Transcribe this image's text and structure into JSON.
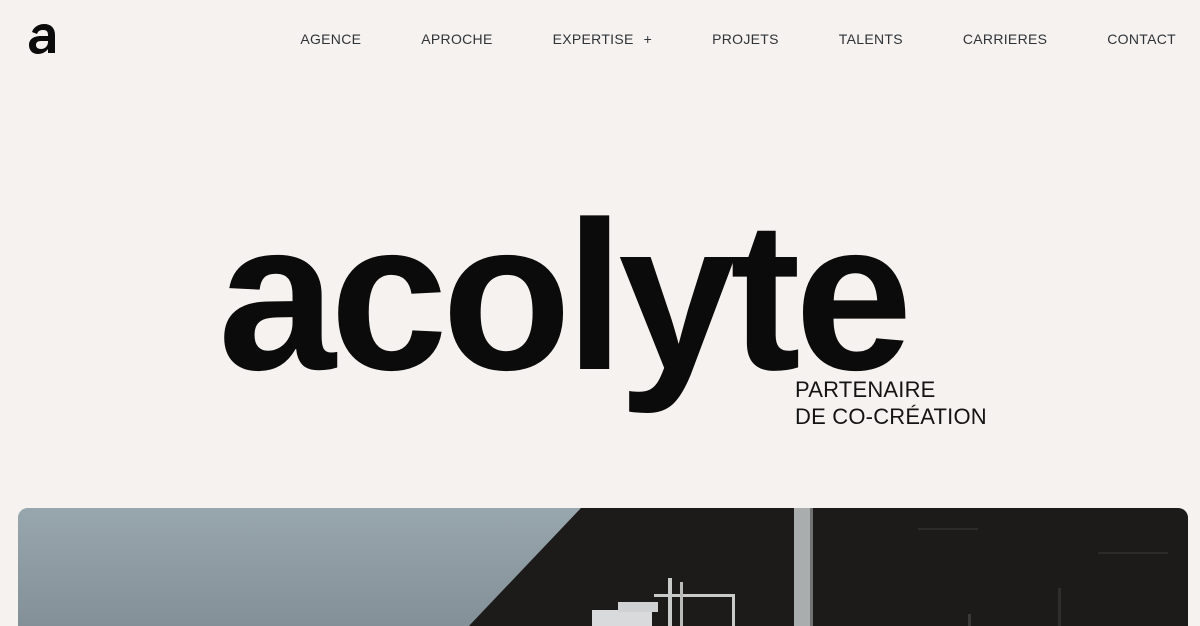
{
  "header": {
    "logo_label": "acolyte",
    "nav": [
      {
        "label": "AGENCE"
      },
      {
        "label": "APROCHE"
      },
      {
        "label": "EXPERTISE",
        "expand_symbol": "+"
      },
      {
        "label": "PROJETS"
      },
      {
        "label": "TALENTS"
      },
      {
        "label": "CARRIERES"
      },
      {
        "label": "CONTACT"
      }
    ]
  },
  "hero": {
    "wordmark": "acolyte",
    "tagline_line1": "PARTENAIRE",
    "tagline_line2": "DE CO-CRÉATION"
  },
  "colors": {
    "background": "#f6f2ef",
    "text": "#0b0b0b",
    "nav_text": "#2e3338",
    "sky": "#8e9ba3",
    "building": "#1c1b1a"
  },
  "icons": {
    "logo": "acolyte-a-logo-icon",
    "expand": "plus-icon"
  }
}
